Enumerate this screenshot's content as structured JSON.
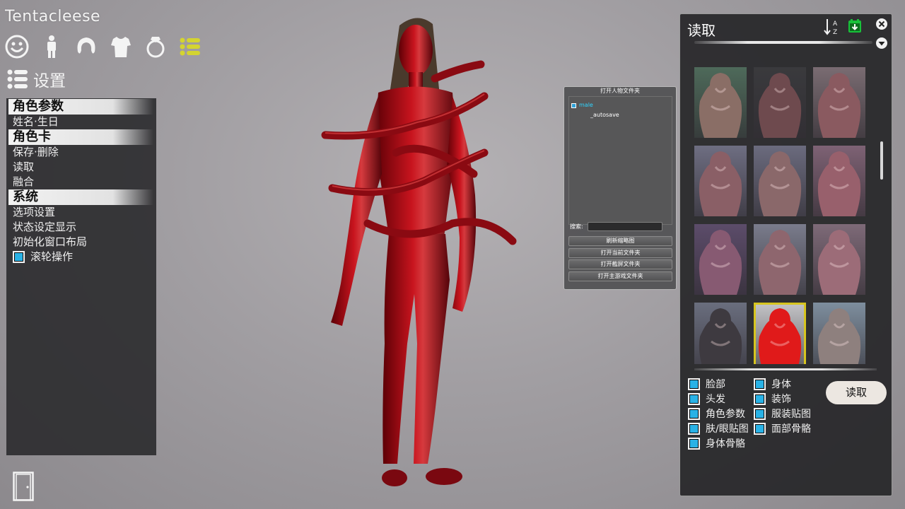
{
  "app": {
    "title": "Tentacleese"
  },
  "category_bar": [
    {
      "icon": "face-icon"
    },
    {
      "icon": "body-icon"
    },
    {
      "icon": "hair-icon"
    },
    {
      "icon": "clothing-icon"
    },
    {
      "icon": "accessory-ring-icon"
    },
    {
      "icon": "list-settings-icon",
      "active": true
    }
  ],
  "settings": {
    "heading": "设置"
  },
  "left_menu": {
    "section_character_params": "角色参数",
    "name_birthday": "姓名·生日",
    "section_character_card": "角色卡",
    "save_delete": "保存·删除",
    "load": "读取",
    "merge": "融合",
    "section_system": "系统",
    "option_settings": "选项设置",
    "status_display": "状态设定显示",
    "reset_layout": "初始化窗口布局",
    "wheel_operation": "滚轮操作"
  },
  "folder_panel": {
    "title": "打开人物文件夹",
    "tree_root": "male",
    "tree_child": "_autosave",
    "search_label": "搜索:",
    "search_value": "",
    "buttons": [
      "刷新缩略图",
      "打开当前文件夹",
      "打开截屏文件夹",
      "打开主游戏文件夹"
    ]
  },
  "load_panel": {
    "title": "读取",
    "thumbnails": [
      {
        "bg": "#4e6a5a",
        "fg": "#8a6e66",
        "selected": false
      },
      {
        "bg": "#3a3a3d",
        "fg": "#6e4a4e",
        "selected": false
      },
      {
        "bg": "#7a6c72",
        "fg": "#8a5a60",
        "selected": false
      },
      {
        "bg": "#6e6e82",
        "fg": "#8a5f66",
        "selected": false
      },
      {
        "bg": "#6b6b7e",
        "fg": "#8a686a",
        "selected": false
      },
      {
        "bg": "#7e6274",
        "fg": "#98606c",
        "selected": false
      },
      {
        "bg": "#5c4c6a",
        "fg": "#875a72",
        "selected": false
      },
      {
        "bg": "#7a7c8c",
        "fg": "#8e666e",
        "selected": false
      },
      {
        "bg": "#7e6a78",
        "fg": "#9c6c78",
        "selected": false
      },
      {
        "bg": "#6a6e7e",
        "fg": "#3e3a40",
        "selected": false
      },
      {
        "bg": "#c5c5c8",
        "fg": "#e01a1a",
        "selected": true
      },
      {
        "bg": "#7e8e9e",
        "fg": "#8e807e",
        "selected": false
      }
    ],
    "options": [
      {
        "label": "脸部",
        "checked": true
      },
      {
        "label": "身体",
        "checked": true
      },
      {
        "label": "头发",
        "checked": true
      },
      {
        "label": "装饰",
        "checked": true
      },
      {
        "label": "角色参数",
        "checked": true
      },
      {
        "label": "服装贴图",
        "checked": true
      },
      {
        "label": "肤/眼贴图",
        "checked": true
      },
      {
        "label": "面部骨骼",
        "checked": true
      },
      {
        "label": "身体骨骼",
        "checked": true
      }
    ],
    "load_button": "读取"
  },
  "colors": {
    "accent_checkbox": "#29b2e6",
    "selected_thumb": "#d7c51f",
    "active_icon": "#d4d430",
    "character_red": "#b0101a"
  }
}
